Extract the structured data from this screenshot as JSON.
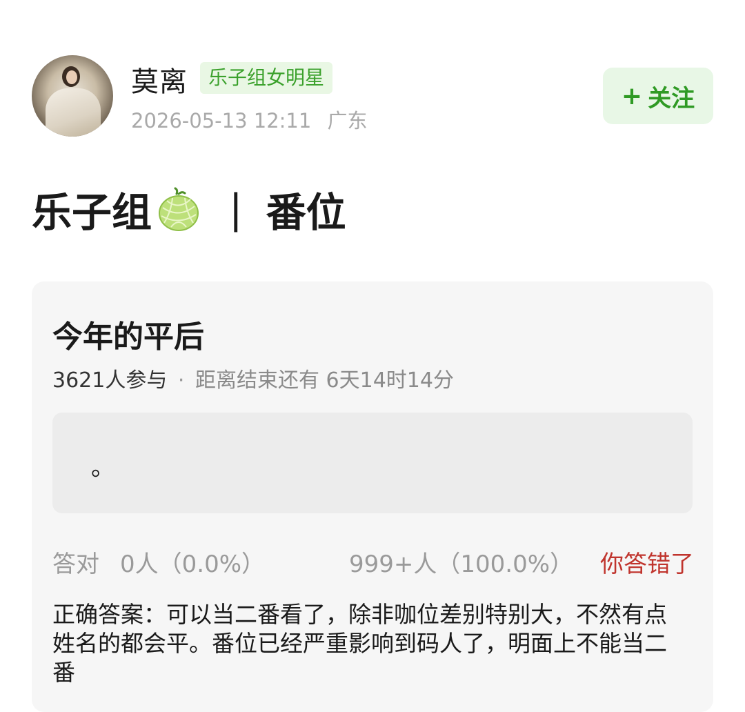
{
  "header": {
    "username": "莫离",
    "badge": "乐子组女明星",
    "timestamp": "2026-05-13 12:11",
    "location": "广东",
    "follow_label": "关注",
    "follow_plus": "+"
  },
  "headline": {
    "part1": "乐子组",
    "emoji_icon": "melon-icon",
    "separator": "|",
    "part2": "番位"
  },
  "quiz": {
    "title": "今年的平后",
    "participants": "3621人参与",
    "dot": "·",
    "countdown": "距离结束还有 6天14时14分",
    "answer_text": "。",
    "correct_label": "答对",
    "correct_value": "0人（0.0%）",
    "wrong_value": "999+人（100.0%）",
    "wrong_label": "你答错了",
    "explanation": "正确答案：可以当二番看了，除非咖位差别特别大，不然有点姓名的都会平。番位已经严重影响到码人了，明面上不能当二番"
  },
  "colors": {
    "accent_green": "#2f9a24",
    "badge_bg": "#e9f7e4",
    "wrong_red": "#c0342d",
    "card_bg": "#f6f6f6"
  }
}
